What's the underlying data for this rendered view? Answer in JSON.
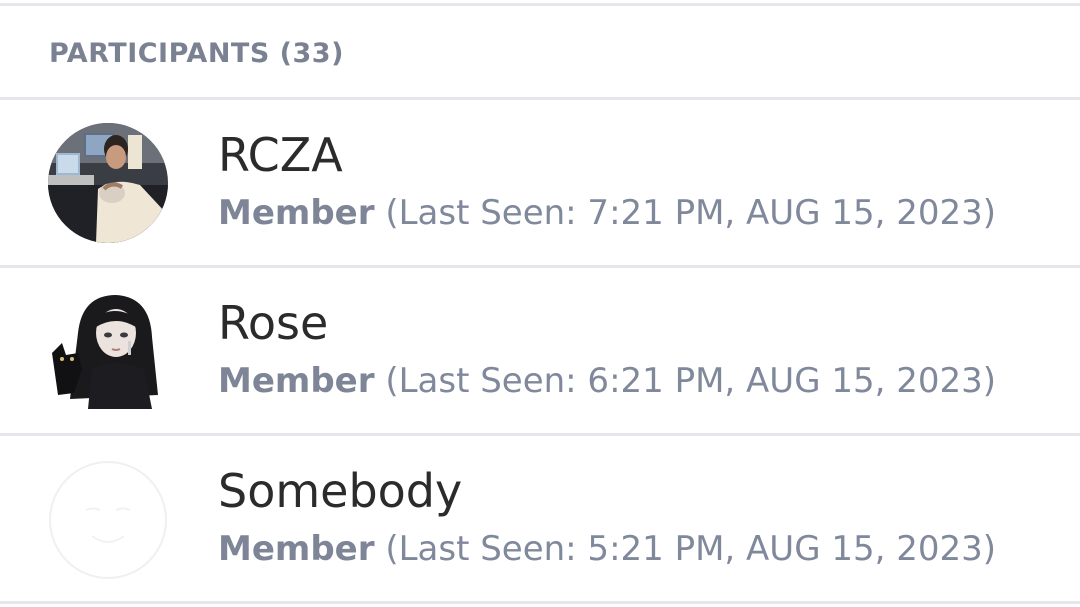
{
  "participants": {
    "header_label": "PARTICIPANTS (33)",
    "items": [
      {
        "name": "RCZA",
        "role": "Member",
        "last_seen": "(Last Seen: 7:21 PM, AUG 15, 2023)",
        "avatar": "photo-avatar"
      },
      {
        "name": "Rose",
        "role": "Member",
        "last_seen": "(Last Seen: 6:21 PM, AUG 15, 2023)",
        "avatar": "illustrated-avatar"
      },
      {
        "name": "Somebody",
        "role": "Member",
        "last_seen": "(Last Seen: 5:21 PM, AUG 15, 2023)",
        "avatar": "blank-face-avatar"
      }
    ]
  },
  "colors": {
    "header_text": "#7a8192",
    "name_text": "#2b2b2b",
    "meta_text": "#80899b",
    "divider": "#e6e7ea"
  }
}
